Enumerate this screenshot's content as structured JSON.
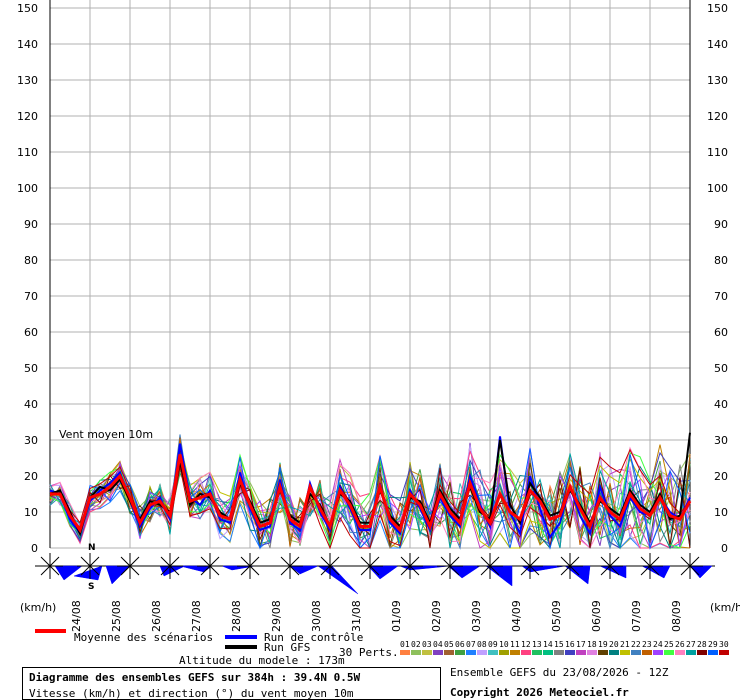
{
  "chart_data": {
    "type": "line",
    "title": "Diagramme des ensembles GEFS sur 384h : 39.4N 0.5W",
    "subtitle": "Vitesse (km/h) et direction (°) du vent moyen 10m",
    "annotation": "Vent moyen 10m",
    "ylabel_left": "(km/h)",
    "ylabel_right": "(km/h)",
    "ylim": [
      0,
      150
    ],
    "yticks": [
      0,
      10,
      20,
      30,
      40,
      50,
      60,
      70,
      80,
      90,
      100,
      110,
      120,
      130,
      140,
      150
    ],
    "date_labels": [
      "24/08",
      "25/08",
      "26/08",
      "27/08",
      "28/08",
      "29/08",
      "30/08",
      "31/08",
      "01/09",
      "02/09",
      "03/09",
      "04/09",
      "05/09",
      "06/09",
      "07/09",
      "08/09"
    ],
    "time_step_h": 6,
    "time_range_h": [
      0,
      384
    ],
    "grid": true,
    "series": [
      {
        "name": "Moyenne des scénarios",
        "color": "#ff0000",
        "values": [
          15,
          15,
          9,
          5,
          14,
          15,
          17,
          20,
          14,
          7,
          12,
          13,
          9,
          26,
          13,
          14,
          15,
          9,
          8,
          19,
          12,
          6,
          7,
          17,
          8,
          6,
          17,
          11,
          6,
          16,
          12,
          6,
          6,
          17,
          8,
          5,
          15,
          12,
          6,
          15,
          10,
          7,
          18,
          11,
          7,
          15,
          10,
          8,
          16,
          13,
          8,
          9,
          17,
          11,
          6,
          14,
          10,
          8,
          15,
          11,
          9,
          14,
          9,
          8,
          13
        ]
      },
      {
        "name": "Run de contrôle",
        "color": "#0000ff",
        "values": [
          16,
          15,
          8,
          4,
          13,
          16,
          18,
          21,
          13,
          6,
          11,
          14,
          8,
          29,
          14,
          12,
          16,
          8,
          7,
          21,
          11,
          5,
          6,
          19,
          7,
          5,
          18,
          10,
          5,
          17,
          11,
          5,
          5,
          18,
          7,
          4,
          16,
          11,
          5,
          14,
          9,
          6,
          20,
          12,
          6,
          31,
          10,
          4,
          20,
          11,
          3,
          7,
          17,
          9,
          4,
          17,
          9,
          6,
          14,
          10,
          9,
          14,
          10,
          8,
          14
        ]
      },
      {
        "name": "Run GFS",
        "color": "#000000",
        "values": [
          15,
          16,
          10,
          4,
          14,
          17,
          16,
          19,
          13,
          8,
          13,
          12,
          10,
          24,
          12,
          15,
          14,
          10,
          8,
          18,
          13,
          7,
          8,
          16,
          9,
          7,
          15,
          12,
          6,
          15,
          13,
          7,
          7,
          16,
          9,
          6,
          14,
          13,
          7,
          16,
          11,
          8,
          17,
          10,
          8,
          30,
          12,
          7,
          18,
          14,
          9,
          10,
          16,
          12,
          7,
          13,
          11,
          9,
          16,
          12,
          10,
          15,
          8,
          9,
          32
        ]
      }
    ],
    "perts_label": "30 Perts.",
    "perts_numbers": [
      "01",
      "02",
      "03",
      "04",
      "05",
      "06",
      "07",
      "08",
      "09",
      "10",
      "11",
      "12",
      "13",
      "14",
      "15",
      "16",
      "17",
      "18",
      "19",
      "20",
      "21",
      "22",
      "23",
      "24",
      "25",
      "26",
      "27",
      "28",
      "29",
      "30"
    ],
    "perts_colors": [
      "#ff8040",
      "#8ec05c",
      "#c0c040",
      "#8040c0",
      "#a06030",
      "#40a040",
      "#2080ff",
      "#c0a0ff",
      "#40c0c0",
      "#a0a000",
      "#c08000",
      "#ff4080",
      "#20c060",
      "#00c080",
      "#808080",
      "#4040c0",
      "#c040c0",
      "#e080e0",
      "#604000",
      "#008080",
      "#c0c000",
      "#4080c0",
      "#c06000",
      "#a040ff",
      "#40ff40",
      "#ff80c0",
      "#00a0a0",
      "#800000",
      "#0060ff",
      "#c00000"
    ],
    "directions_deg": [
      225,
      135,
      0,
      90,
      0,
      0,
      270,
      0,
      300,
      0,
      0,
      0,
      0,
      45,
      0,
      0
    ]
  },
  "legend": {
    "mean_label": "Moyenne des scénarios",
    "control_label": "Run de contrôle",
    "gfs_label": "Run GFS"
  },
  "info": {
    "altitude": "Altitude du modele : 173m",
    "ensemble_date": "Ensemble GEFS du 23/08/2026 - 12Z",
    "copyright": "Copyright 2026 Meteociel.fr"
  },
  "compass": {
    "north": "N",
    "south": "S"
  }
}
